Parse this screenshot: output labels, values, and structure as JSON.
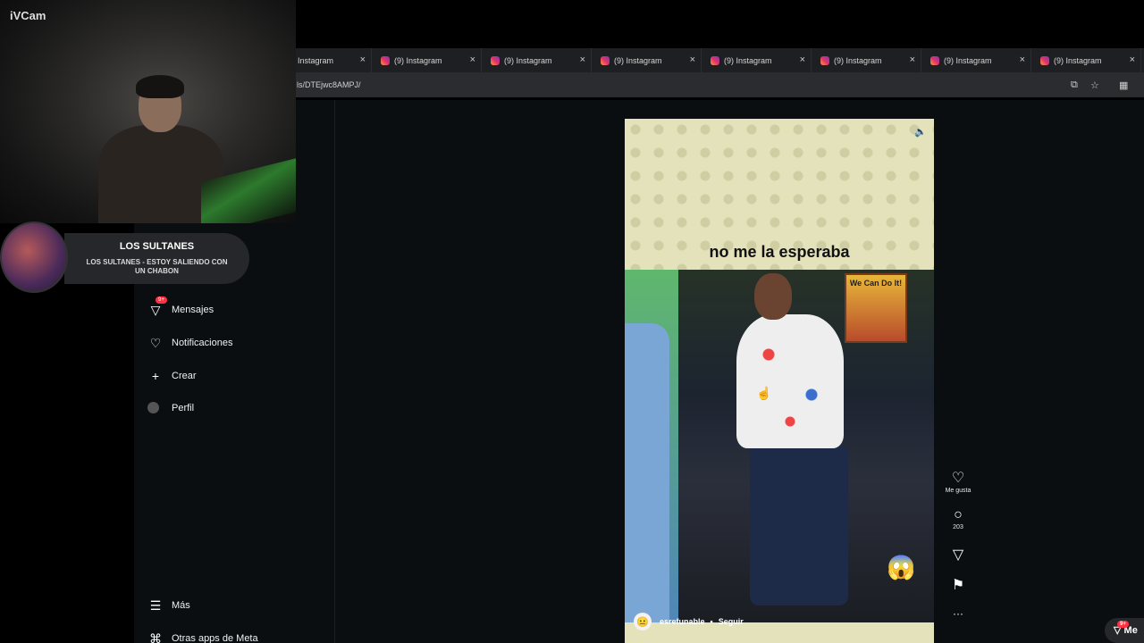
{
  "webcam": {
    "label": "iVCam"
  },
  "now_playing": {
    "title": "LOS SULTANES",
    "subtitle": "LOS SULTANES - ESTOY SALIENDO CON UN CHABON"
  },
  "browser": {
    "tabs": [
      {
        "label": "Instagram",
        "close": "×"
      },
      {
        "label": "(9) Instagram",
        "close": "×"
      },
      {
        "label": "(9) Instagram",
        "close": "×"
      },
      {
        "label": "(9) Instagram",
        "close": "×"
      },
      {
        "label": "(9) Instagram",
        "close": "×"
      },
      {
        "label": "(9) Instagram",
        "close": "×"
      },
      {
        "label": "(9) Instagram",
        "close": "×"
      },
      {
        "label": "(9) Instagram",
        "close": "×"
      }
    ],
    "url": "ls/DTEjwc8AMPJ/"
  },
  "sidebar": {
    "items": [
      {
        "label": "Mensajes",
        "badge": "9+"
      },
      {
        "label": "Notificaciones"
      },
      {
        "label": "Crear"
      },
      {
        "label": "Perfil"
      },
      {
        "label": "Más"
      },
      {
        "label": "Otras apps de Meta"
      }
    ]
  },
  "reel": {
    "caption": "no me la esperaba",
    "poster_text": "We Can Do It!",
    "username": "esrefunable",
    "follow_label": "Seguir",
    "separator": "•"
  },
  "actions": {
    "like_label": "Me gusta",
    "comment_count": "203",
    "more": "···"
  },
  "messages_pill": {
    "label": "Me",
    "badge": "9+"
  }
}
